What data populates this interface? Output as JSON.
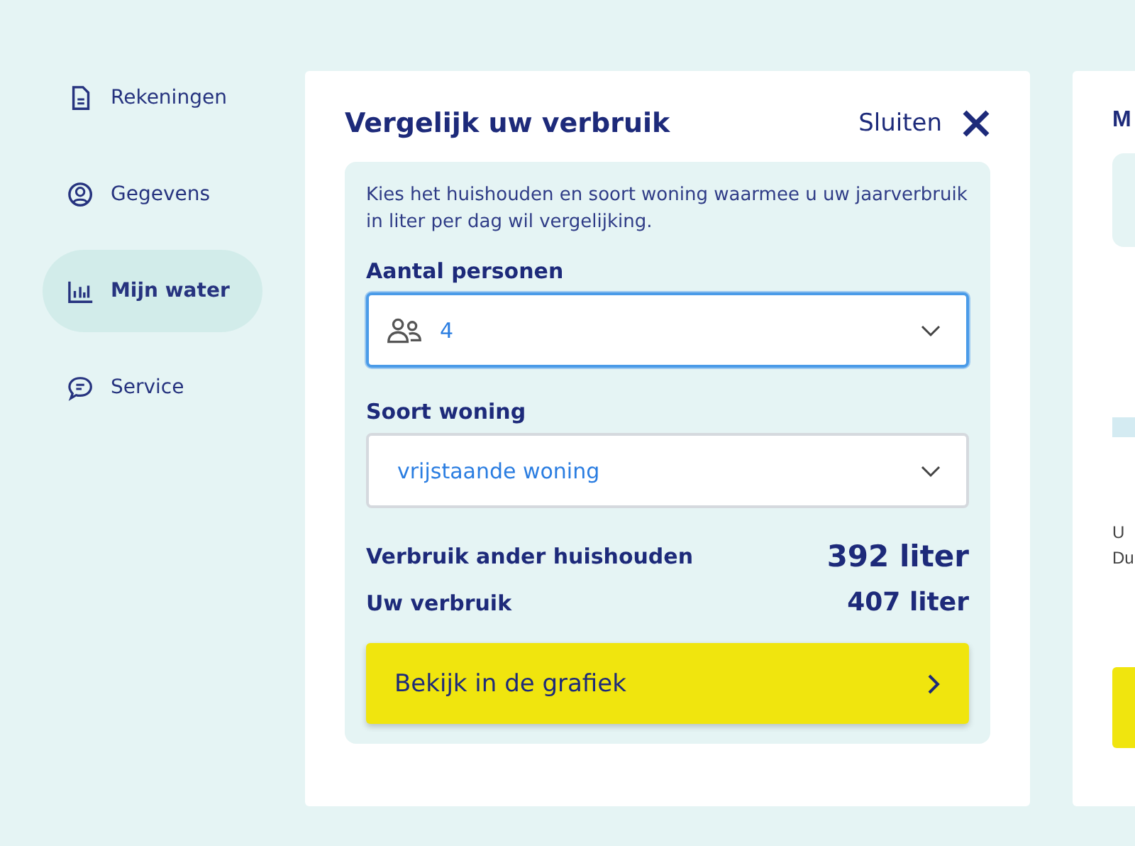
{
  "sidebar": {
    "items": [
      {
        "label": "Rekeningen",
        "selected": false
      },
      {
        "label": "Gegevens",
        "selected": false
      },
      {
        "label": "Mijn water",
        "selected": true
      },
      {
        "label": "Service",
        "selected": false
      }
    ]
  },
  "compare_panel": {
    "title": "Vergelijk uw verbruik",
    "close_label": "Sluiten",
    "intro": "Kies het huishouden en soort woning waarmee u uw jaarverbruik in liter per dag wil vergelijking.",
    "fields": [
      {
        "label": "Aantal personen",
        "value": "4",
        "kind": "people",
        "focused": true
      },
      {
        "label": "Soort woning",
        "value": "vrijstaande woning",
        "focused": false
      }
    ],
    "results": [
      {
        "label": "Verbruik ander huishouden",
        "value": "392 liter",
        "emphasis": true
      },
      {
        "label": "Uw verbruik",
        "value": "407 liter",
        "emphasis": false
      }
    ],
    "button": "Bekijk in de grafiek"
  },
  "side_card": {
    "title": "M",
    "lines": [
      "U",
      "Du"
    ]
  }
}
